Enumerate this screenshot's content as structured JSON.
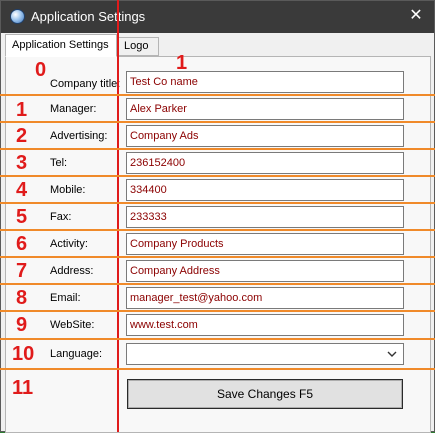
{
  "window": {
    "title": "Application Settings",
    "close_symbol": "✕"
  },
  "tabs": [
    {
      "label": "Application Settings",
      "active": true
    },
    {
      "label": "Logo",
      "active": false
    }
  ],
  "fields": [
    {
      "label": "Company title:",
      "value": "Test Co name"
    },
    {
      "label": "Manager:",
      "value": "Alex Parker"
    },
    {
      "label": "Advertising:",
      "value": "Company Ads"
    },
    {
      "label": "Tel:",
      "value": "236152400"
    },
    {
      "label": "Mobile:",
      "value": "334400"
    },
    {
      "label": "Fax:",
      "value": "233333"
    },
    {
      "label": "Activity:",
      "value": "Company Products"
    },
    {
      "label": "Address:",
      "value": "Company Address"
    },
    {
      "label": "Email:",
      "value": "manager_test@yahoo.com"
    },
    {
      "label": "WebSite:",
      "value": "www.test.com"
    }
  ],
  "language": {
    "label": "Language:",
    "value": ""
  },
  "save_button": {
    "label": "Save Changes F5"
  },
  "annotations": {
    "numbers": [
      "0",
      "1",
      "1",
      "2",
      "3",
      "4",
      "5",
      "6",
      "7",
      "8",
      "9",
      "10",
      "11"
    ],
    "number_color": "#e01b1b",
    "line_color": "#f08a2a"
  },
  "colors": {
    "titlebar": "#3a3a3a",
    "field_text": "#8b0000",
    "background": "#2e7d32"
  }
}
